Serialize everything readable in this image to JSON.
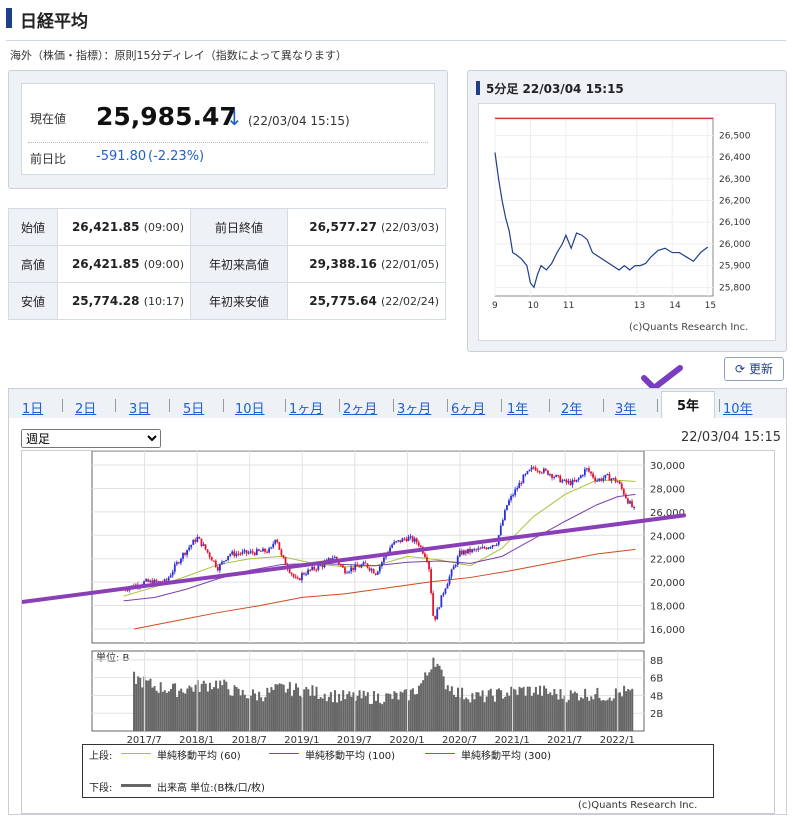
{
  "header": {
    "title": "日経平均",
    "notice": "海外（株価・指標）：原則15分ディレイ（指数によって異なります）"
  },
  "quote": {
    "current_label": "現在値",
    "current_value": "25,985.47",
    "arrow": "↓",
    "timestamp": "(22/03/04 15:15)",
    "change_label": "前日比",
    "change": "-591.80",
    "change_pct": "(-2.23%)"
  },
  "stats": {
    "open_label": "始値",
    "open": "26,421.85",
    "open_time": "(09:00)",
    "prev_label": "前日終値",
    "prev": "26,577.27",
    "prev_date": "(22/03/03)",
    "high_label": "高値",
    "high": "26,421.85",
    "high_time": "(09:00)",
    "ytd_high_label": "年初来高値",
    "ytd_high": "29,388.16",
    "ytd_high_date": "(22/01/05)",
    "low_label": "安値",
    "low": "25,774.28",
    "low_time": "(10:17)",
    "ytd_low_label": "年初来安値",
    "ytd_low": "25,775.64",
    "ytd_low_date": "(22/02/24)"
  },
  "intraday": {
    "title": "5分足 22/03/04 15:15",
    "credit": "(c)Quants Research Inc."
  },
  "refresh_label": "更新",
  "tabs": [
    "1日",
    "2日",
    "3日",
    "5日",
    "10日",
    "1ヶ月",
    "2ヶ月",
    "3ヶ月",
    "6ヶ月",
    "1年",
    "2年",
    "3年",
    "5年",
    "10年"
  ],
  "active_tab": "5年",
  "period_select": "週足",
  "chart_timestamp": "22/03/04 15:15",
  "volume_unit_label": "単位: B",
  "legend": {
    "upper_label": "上段:",
    "ma60": "単純移動平均 (60)",
    "ma100": "単純移動平均 (100)",
    "ma300": "単純移動平均 (300)",
    "lower_label": "下段:",
    "volume": "出来高 単位:(B株/口/枚)"
  },
  "colors": {
    "candle_up": "#2b2fd8",
    "candle_down": "#e0142c",
    "ma60": "#a9c23a",
    "ma100": "#7b3fb0",
    "ma300": "#d04a1e",
    "trendline": "#8a3fb8",
    "accent": "#1f3f8a"
  },
  "icons": {
    "check": "checkmark-icon",
    "refresh": "refresh-icon"
  },
  "chart_data": [
    {
      "type": "line",
      "title": "5分足 22/03/04 15:15",
      "x_ticks": [
        "9",
        "10",
        "11",
        "13",
        "14",
        "15"
      ],
      "y_ticks": [
        "25,800",
        "25,900",
        "26,000",
        "26,100",
        "26,200",
        "26,300",
        "26,400",
        "26,500"
      ],
      "ylim": [
        25760,
        26580
      ],
      "reference_line": 26577.27,
      "series": [
        {
          "x": [
            9.0,
            9.1,
            9.2,
            9.3,
            9.4,
            9.5,
            9.6,
            9.75,
            9.9,
            10.0,
            10.1,
            10.2,
            10.3,
            10.45,
            10.6,
            10.75,
            10.9,
            11.0,
            11.15,
            11.3,
            11.45,
            11.6,
            11.75,
            12.5,
            12.65,
            12.8,
            12.95,
            13.1,
            13.25,
            13.4,
            13.6,
            13.8,
            14.0,
            14.2,
            14.4,
            14.6,
            14.8,
            15.0
          ],
          "values": [
            26421,
            26300,
            26200,
            26120,
            26060,
            25960,
            25950,
            25930,
            25900,
            25820,
            25800,
            25860,
            25900,
            25880,
            25910,
            25960,
            26000,
            26040,
            25980,
            26050,
            26040,
            26020,
            25960,
            25880,
            25900,
            25880,
            25900,
            25900,
            25910,
            25940,
            25970,
            25980,
            25960,
            25960,
            25940,
            25920,
            25960,
            25985
          ]
        }
      ]
    },
    {
      "type": "line",
      "title": "",
      "x_ticks": [
        "2017/7",
        "2018/1",
        "2018/7",
        "2019/1",
        "2019/7",
        "2020/1",
        "2020/7",
        "2021/1",
        "2021/7",
        "2022/1"
      ],
      "y_ticks": [
        "16,000",
        "18,000",
        "20,000",
        "22,000",
        "24,000",
        "26,000",
        "28,000",
        "30,000"
      ],
      "ylim": [
        14800,
        31200
      ],
      "x_range": [
        2017.0,
        2022.25
      ],
      "series": [
        {
          "name": "",
          "x": [
            2017.3,
            2017.5,
            2017.7,
            2017.85,
            2018.0,
            2018.05,
            2018.2,
            2018.3,
            2018.5,
            2018.7,
            2018.75,
            2018.8,
            2018.95,
            2019.0,
            2019.2,
            2019.3,
            2019.4,
            2019.6,
            2019.7,
            2019.85,
            2020.0,
            2020.1,
            2020.2,
            2020.25,
            2020.35,
            2020.5,
            2020.7,
            2020.85,
            2020.95,
            2021.1,
            2021.2,
            2021.35,
            2021.5,
            2021.6,
            2021.7,
            2021.8,
            2021.9,
            2022.0,
            2022.1,
            2022.17
          ],
          "values": [
            19400,
            20000,
            20000,
            22200,
            23800,
            23200,
            21200,
            22400,
            22500,
            22700,
            24000,
            22200,
            20000,
            20700,
            21500,
            22200,
            21000,
            21500,
            20800,
            23200,
            23800,
            23400,
            21800,
            16600,
            19400,
            22500,
            22800,
            23400,
            26700,
            28900,
            29800,
            29300,
            28500,
            28500,
            29700,
            28700,
            29000,
            28600,
            26900,
            25985
          ]
        },
        {
          "name": "単純移動平均 (60)",
          "x": [
            2017.3,
            2017.6,
            2017.9,
            2018.2,
            2018.5,
            2018.8,
            2019.1,
            2019.4,
            2019.7,
            2020.0,
            2020.3,
            2020.6,
            2020.9,
            2021.2,
            2021.5,
            2021.8,
            2022.0,
            2022.17
          ],
          "values": [
            18800,
            19600,
            20500,
            21500,
            22000,
            22200,
            21600,
            21300,
            21400,
            22200,
            21900,
            21400,
            22900,
            25600,
            27500,
            28700,
            28700,
            28600
          ]
        },
        {
          "name": "単純移動平均 (100)",
          "x": [
            2017.3,
            2017.6,
            2017.9,
            2018.2,
            2018.5,
            2018.8,
            2019.1,
            2019.4,
            2019.7,
            2020.0,
            2020.3,
            2020.6,
            2020.9,
            2021.2,
            2021.5,
            2021.8,
            2022.0,
            2022.17
          ],
          "values": [
            18400,
            18700,
            19400,
            20300,
            21000,
            21500,
            21600,
            21500,
            21400,
            21700,
            21800,
            21600,
            22200,
            23700,
            25200,
            26600,
            27300,
            27500
          ]
        },
        {
          "name": "単純移動平均 (300)",
          "x": [
            2017.4,
            2017.8,
            2018.2,
            2018.6,
            2019.0,
            2019.4,
            2019.8,
            2020.2,
            2020.6,
            2021.0,
            2021.4,
            2021.8,
            2022.17
          ],
          "values": [
            16000,
            16700,
            17400,
            18000,
            18700,
            19000,
            19500,
            20000,
            20400,
            21000,
            21700,
            22400,
            22800
          ]
        }
      ]
    },
    {
      "type": "bar",
      "title": "",
      "x_ticks": [
        "2017/7",
        "2018/1",
        "2018/7",
        "2019/1",
        "2019/7",
        "2020/1",
        "2020/7",
        "2021/1",
        "2021/7",
        "2022/1"
      ],
      "y_ticks": [
        "2B",
        "4B",
        "6B",
        "8B"
      ],
      "ylim": [
        0,
        9
      ],
      "x": [
        2017.4,
        2017.6,
        2017.8,
        2018.0,
        2018.2,
        2018.4,
        2018.6,
        2018.8,
        2019.0,
        2019.2,
        2019.4,
        2019.6,
        2019.8,
        2020.0,
        2020.1,
        2020.2,
        2020.25,
        2020.35,
        2020.5,
        2020.7,
        2020.9,
        2021.1,
        2021.3,
        2021.5,
        2021.7,
        2021.9,
        2022.05,
        2022.15
      ],
      "values": [
        6.0,
        5.0,
        4.6,
        5.0,
        5.4,
        4.2,
        4.0,
        4.8,
        4.6,
        4.2,
        3.8,
        3.8,
        3.8,
        4.0,
        4.8,
        6.5,
        8.5,
        5.5,
        4.2,
        3.8,
        4.2,
        4.6,
        4.4,
        4.0,
        4.2,
        4.0,
        4.4,
        4.2
      ]
    }
  ]
}
